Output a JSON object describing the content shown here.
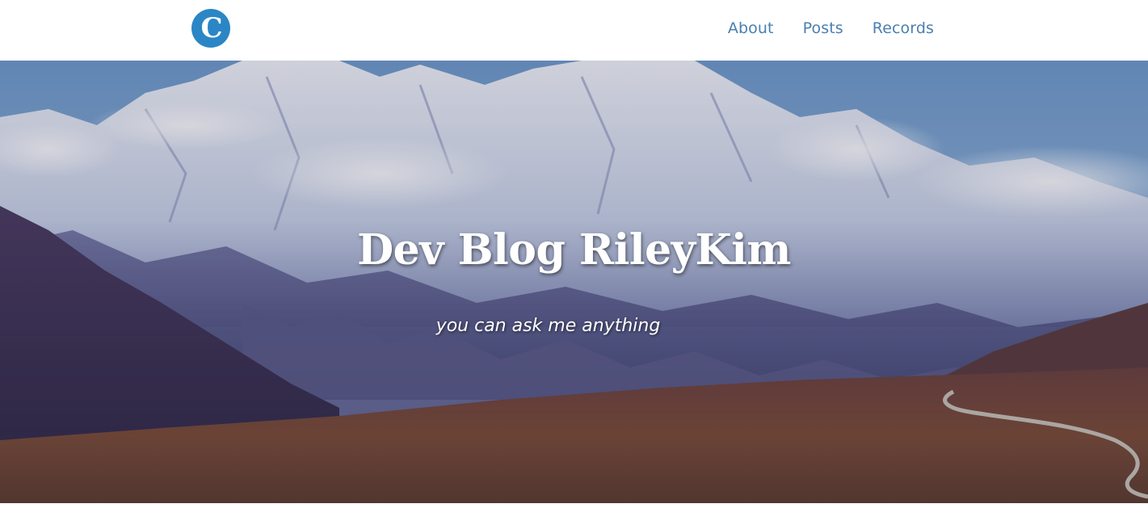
{
  "navbar": {
    "logo_letter": "C",
    "links": [
      {
        "label": "About"
      },
      {
        "label": "Posts"
      },
      {
        "label": "Records"
      }
    ]
  },
  "hero": {
    "title": "Dev Blog RileyKim",
    "subtitle": "you can ask me anything",
    "background_icon": "mountain-landscape-image"
  },
  "colors": {
    "brand": "#2b86c5",
    "nav_link": "#4a7fb1",
    "hero_text": "#ffffff"
  }
}
